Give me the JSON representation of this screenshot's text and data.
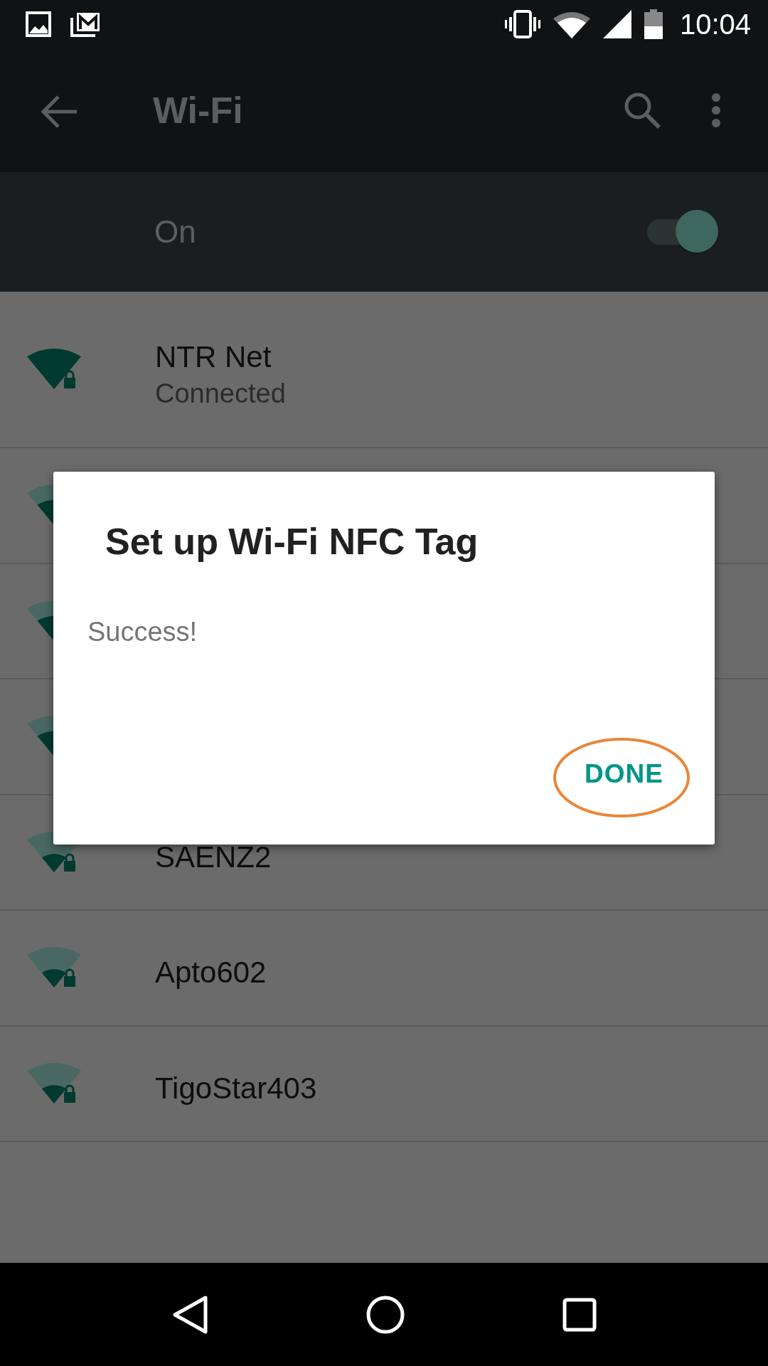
{
  "status_bar": {
    "time": "10:04"
  },
  "app_bar": {
    "title": "Wi-Fi"
  },
  "wifi_switch": {
    "label": "On",
    "on": true
  },
  "networks": [
    {
      "name": "NTR Net",
      "status": "Connected",
      "kind": "full"
    },
    {
      "kind": "strong"
    },
    {
      "kind": "strong"
    },
    {
      "kind": "strong"
    },
    {
      "name": "SAENZ2",
      "kind": "weak"
    },
    {
      "name": "Apto602",
      "kind": "weak"
    },
    {
      "name": "TigoStar403",
      "kind": "weak"
    }
  ],
  "dialog": {
    "title": "Set up Wi-Fi NFC Tag",
    "message": "Success!",
    "buttons": [
      {
        "label": "DONE",
        "highlighted": true
      }
    ]
  }
}
